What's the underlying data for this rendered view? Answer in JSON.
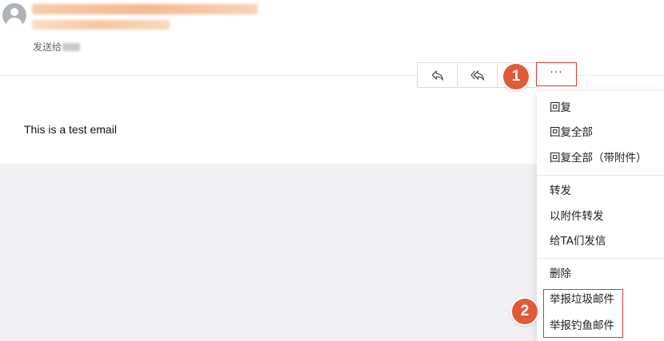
{
  "header": {
    "to_label": "发送给"
  },
  "toolbar": {
    "reply_icon": "reply-icon",
    "reply_all_icon": "reply-all-icon",
    "more_label": "···"
  },
  "email": {
    "body": "This is a test email"
  },
  "annotations": {
    "step1": "1",
    "step2": "2"
  },
  "menu": {
    "group1": [
      "回复",
      "回复全部",
      "回复全部（带附件）"
    ],
    "group2": [
      "转发",
      "以附件转发",
      "给TA们发信"
    ],
    "group3": [
      "删除",
      "举报垃圾邮件",
      "举报钓鱼邮件"
    ]
  },
  "colors": {
    "badge": "#e2593a",
    "highlight": "#d9383a",
    "grey_background": "#f1f1f4"
  }
}
